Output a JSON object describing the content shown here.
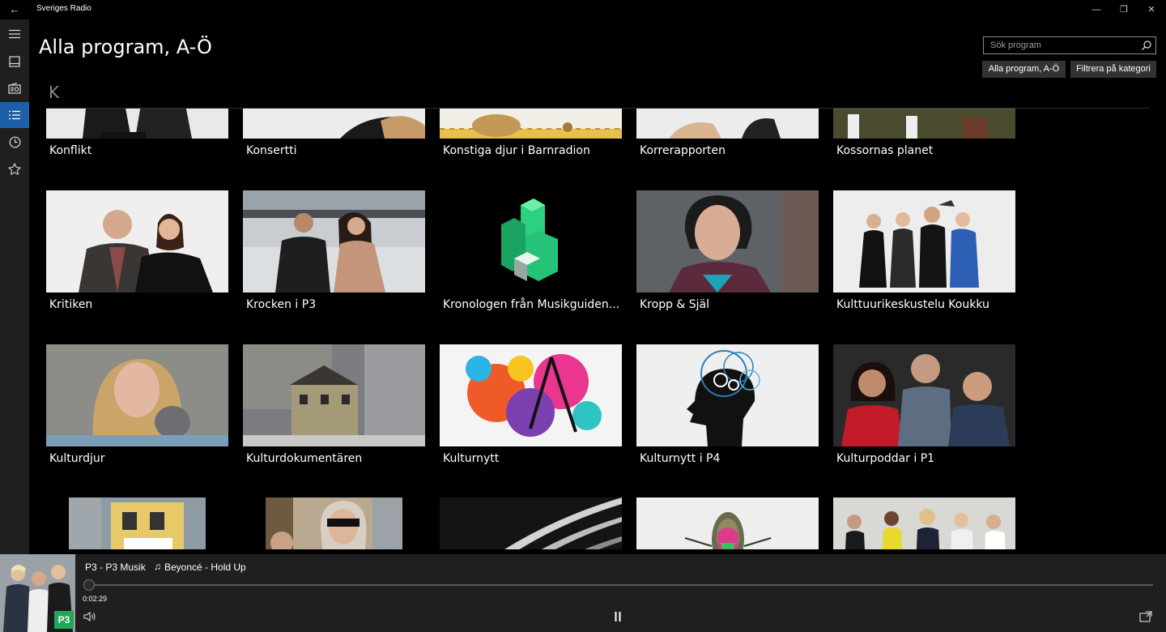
{
  "window": {
    "title": "Sveriges Radio",
    "back_glyph": "←",
    "minimize_glyph": "—",
    "maximize_glyph": "❐",
    "close_glyph": "✕"
  },
  "rail": {
    "items": [
      {
        "icon": "hamburger-menu-icon"
      },
      {
        "icon": "news-feed-icon"
      },
      {
        "icon": "radio-channels-icon"
      },
      {
        "icon": "program-list-icon",
        "active": true
      },
      {
        "icon": "history-clock-icon"
      },
      {
        "icon": "favorites-star-icon"
      }
    ],
    "active_color": "#1d5fa8"
  },
  "header": {
    "title": "Alla program, A-Ö",
    "search_placeholder": "Sök program",
    "btn_all": "Alla program, A-Ö",
    "btn_filter": "Filtrera på kategori"
  },
  "section_letter": "K",
  "programs": [
    {
      "label": "Konflikt"
    },
    {
      "label": "Konsertti"
    },
    {
      "label": "Konstiga djur i Barnradion"
    },
    {
      "label": "Korrerapporten"
    },
    {
      "label": "Kossornas planet"
    },
    {
      "label": "Kritiken"
    },
    {
      "label": "Krocken i P3"
    },
    {
      "label": "Kronologen från Musikguiden..."
    },
    {
      "label": "Kropp & Själ"
    },
    {
      "label": "Kulttuurikeskustelu Koukku"
    },
    {
      "label": "Kulturdjur"
    },
    {
      "label": "Kulturdokumentären"
    },
    {
      "label": "Kulturnytt"
    },
    {
      "label": "Kulturnytt i P4"
    },
    {
      "label": "Kulturpoddar i P1"
    },
    {
      "label": ""
    },
    {
      "label": ""
    },
    {
      "label": ""
    },
    {
      "label": ""
    },
    {
      "label": ""
    }
  ],
  "player": {
    "station": "P3 - P3 Musik",
    "song": "Beyoncé - Hold Up",
    "elapsed": "0:02:29",
    "badge": "P3",
    "badge_color": "#1fa85a"
  }
}
